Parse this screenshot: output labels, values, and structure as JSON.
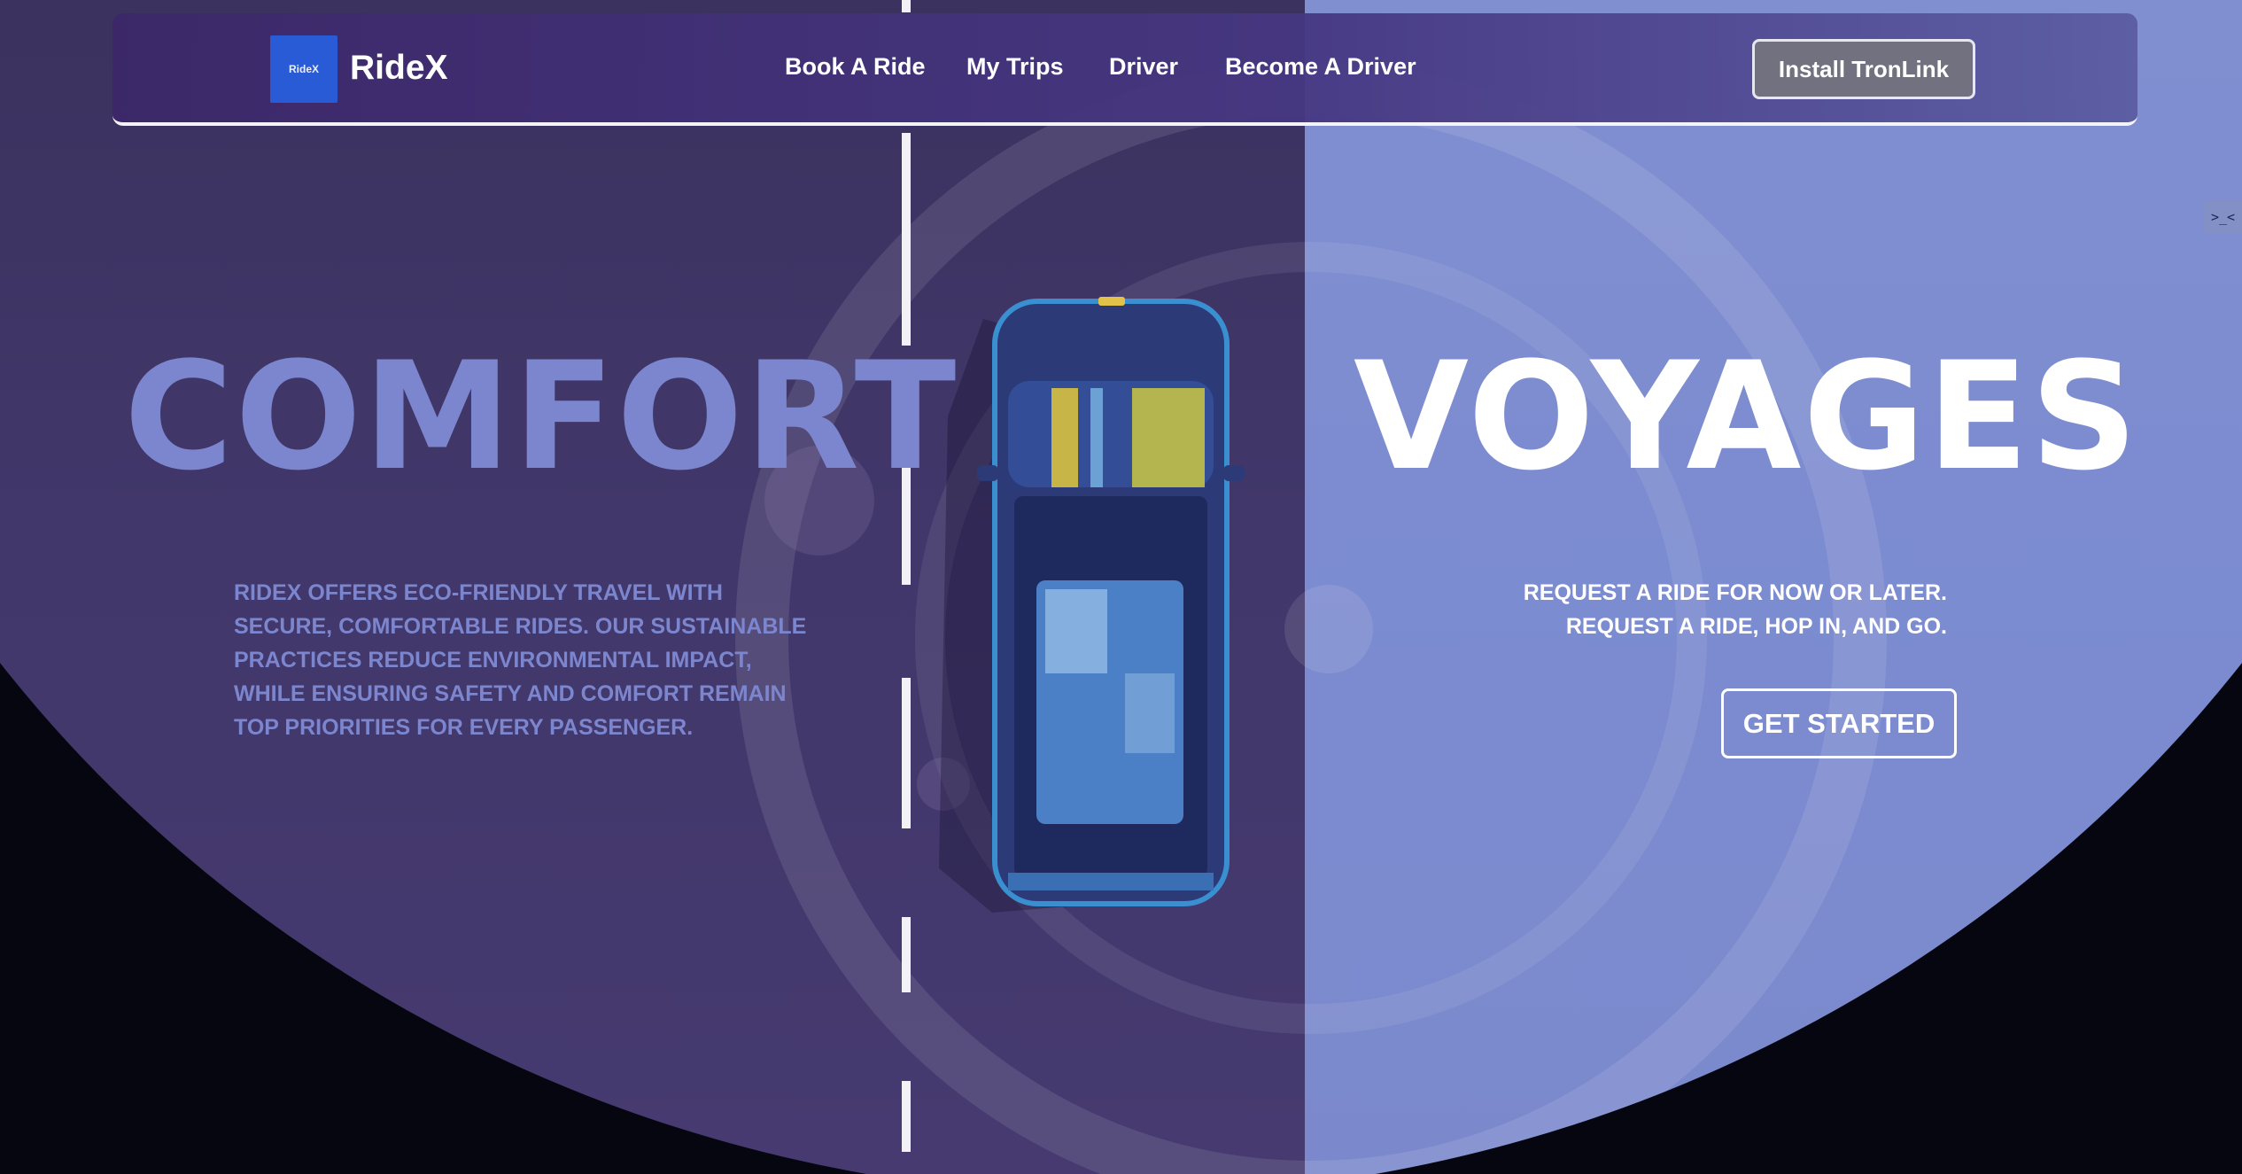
{
  "brand": {
    "logo_text": "RideX",
    "name": "RideX"
  },
  "nav": {
    "links": [
      {
        "label": "Book A Ride"
      },
      {
        "label": "My Trips"
      },
      {
        "label": "Driver"
      },
      {
        "label": "Become A Driver"
      }
    ],
    "install_button": "Install TronLink"
  },
  "hero": {
    "headline_left": "COMFORT",
    "headline_right": "VOYAGES",
    "description_left": "RideX offers eco-friendly travel with secure, comfortable rides. Our sustainable practices reduce environmental impact, while ensuring safety and comfort remain top priorities for every passenger.",
    "description_right_lines": [
      "REQUEST A RIDE FOR NOW OR LATER.",
      "REQUEST A RIDE, HOP IN, AND GO."
    ],
    "cta_label": "GET STARTED"
  },
  "side_tab": {
    "icon": "expand-collapse-icon",
    "glyph": ">_<"
  },
  "colors": {
    "left_panel": "#41376a",
    "right_panel": "#7c8bd0",
    "accent_text": "#7c86cf",
    "logo_blue": "#2a5bd7",
    "install_button_bg": "#71717f"
  }
}
